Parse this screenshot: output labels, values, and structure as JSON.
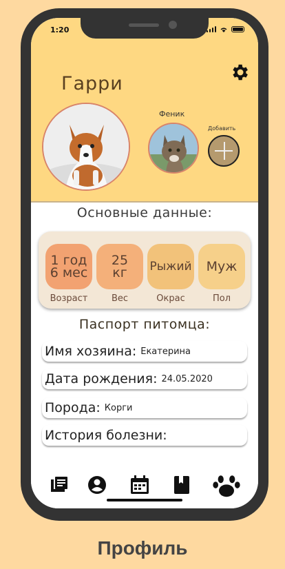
{
  "status": {
    "time": "1:20"
  },
  "profile": {
    "name": "Гарри"
  },
  "other_pet": {
    "name": "Феник"
  },
  "add": {
    "label": "Добавить"
  },
  "basic": {
    "title": "Основные данные:",
    "tiles": [
      {
        "value": "1 год\n6 мес",
        "label": "Возраст",
        "color": "#f2a271"
      },
      {
        "value": "25\nкг",
        "label": "Вес",
        "color": "#f4b07a"
      },
      {
        "value": "Рыжий",
        "label": "Окрас",
        "color": "#f2c27a"
      },
      {
        "value": "Муж",
        "label": "Пол",
        "color": "#f6d08a"
      }
    ]
  },
  "passport": {
    "title": "Паспорт питомца:",
    "owner_key": "Имя хозяина:",
    "owner_val": "Екатерина",
    "birth_key": "Дата рождения:",
    "birth_val": "24.05.2020",
    "breed_key": "Порода:",
    "breed_val": "Корги",
    "history_key": "История болезни:"
  },
  "tabbar": {
    "icons": [
      "news-icon",
      "profile-icon",
      "calendar-icon",
      "book-icon",
      "paw-icon"
    ]
  },
  "caption": "Профиль",
  "colors": {
    "background": "#fed9a0",
    "header": "#fed882",
    "phone": "#333333"
  }
}
